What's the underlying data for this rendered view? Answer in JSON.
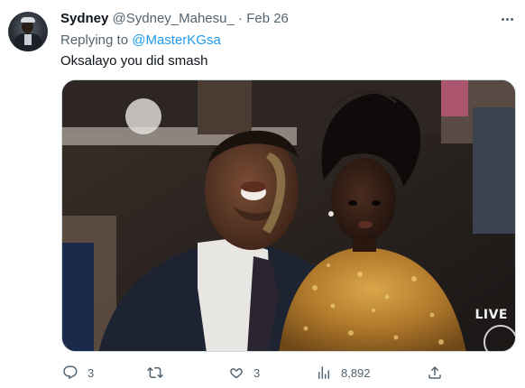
{
  "tweet": {
    "author_name": "Sydney",
    "author_handle": "@Sydney_Mahesu_",
    "separator": "·",
    "date": "Feb 26",
    "replying_prefix": "Replying to",
    "replying_to": "@MasterKGsa",
    "text": "Oksalayo you did smash",
    "media_overlay": "LIVE"
  },
  "actions": {
    "reply_count": "3",
    "retweet_count": "",
    "like_count": "3",
    "view_count": "8,892"
  },
  "icons": {
    "more": "more-icon",
    "reply": "reply-icon",
    "retweet": "retweet-icon",
    "like": "heart-icon",
    "views": "views-icon",
    "share": "share-icon"
  },
  "colors": {
    "link": "#1d9bf0",
    "secondary_text": "#536471",
    "primary_text": "#0f1419"
  }
}
